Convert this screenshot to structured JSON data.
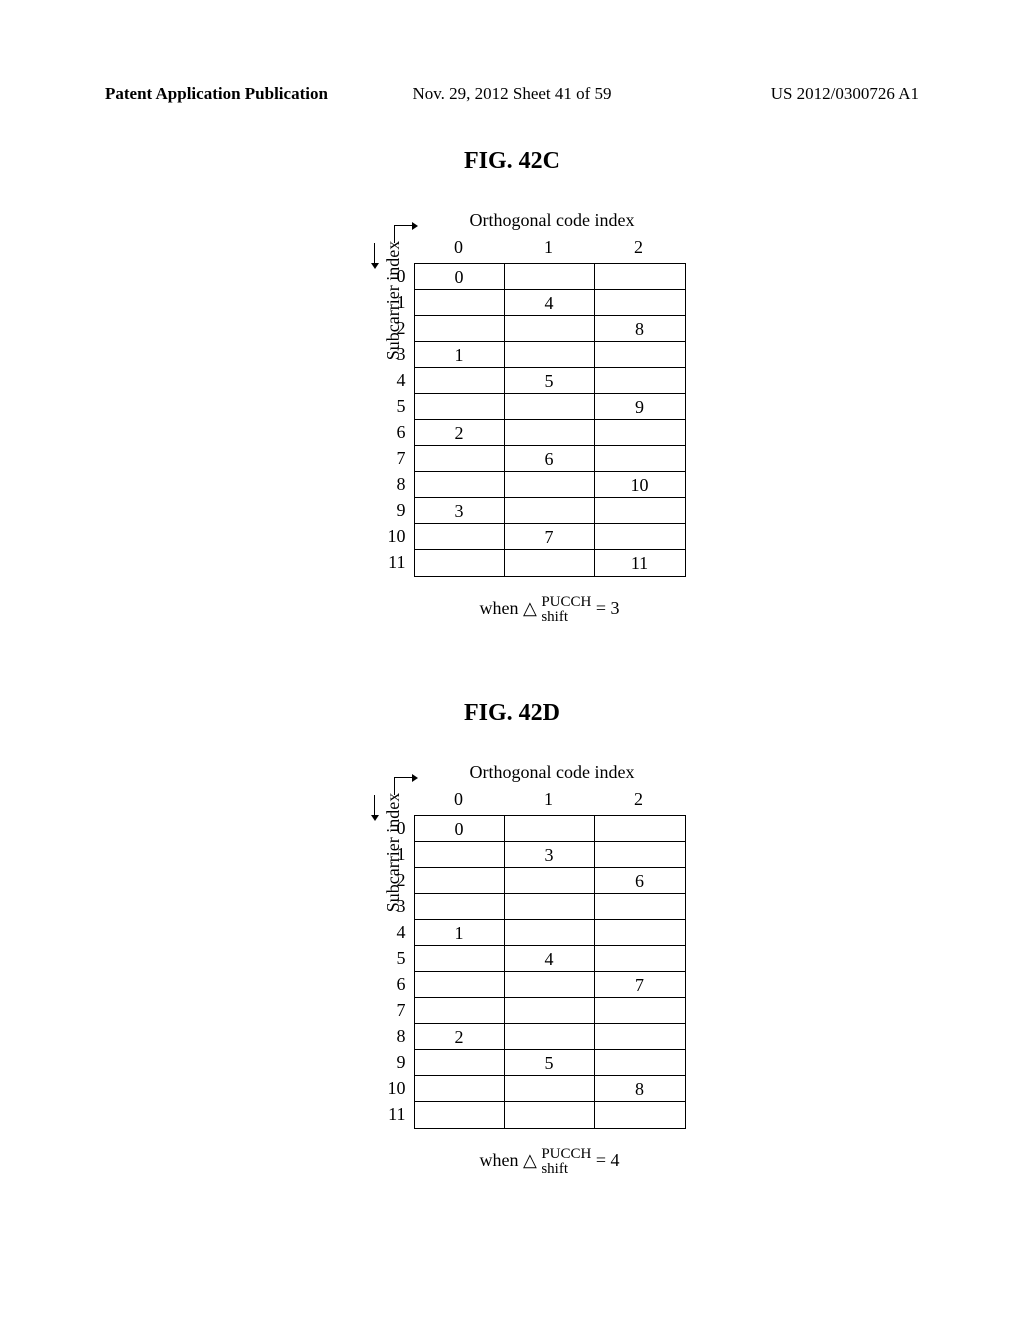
{
  "header": {
    "left": "Patent Application Publication",
    "center": "Nov. 29, 2012  Sheet 41 of 59",
    "right": "US 2012/0300726 A1"
  },
  "figC": {
    "title": "FIG.  42C",
    "topLabel": "Orthogonal code index",
    "sideLabel": "Subcarrier index",
    "colHeaders": [
      "0",
      "1",
      "2"
    ],
    "rowHeaders": [
      "0",
      "1",
      "2",
      "3",
      "4",
      "5",
      "6",
      "7",
      "8",
      "9",
      "10",
      "11"
    ],
    "formula": {
      "when": "when  ",
      "triangle": "△",
      "top": "PUCCH",
      "bot": "shift",
      "equals": " = 3"
    }
  },
  "figD": {
    "title": "FIG.  42D",
    "topLabel": "Orthogonal code index",
    "sideLabel": "Subcarrier index",
    "colHeaders": [
      "0",
      "1",
      "2"
    ],
    "rowHeaders": [
      "0",
      "1",
      "2",
      "3",
      "4",
      "5",
      "6",
      "7",
      "8",
      "9",
      "10",
      "11"
    ],
    "formula": {
      "when": "when  ",
      "triangle": "△",
      "top": "PUCCH",
      "bot": "shift",
      "equals": " = 4"
    }
  },
  "chart_data": [
    {
      "type": "table",
      "title": "FIG. 42C",
      "xlabel": "Orthogonal code index",
      "ylabel": "Subcarrier index",
      "col_headers": [
        0,
        1,
        2
      ],
      "row_headers": [
        0,
        1,
        2,
        3,
        4,
        5,
        6,
        7,
        8,
        9,
        10,
        11
      ],
      "cells": [
        {
          "row": 0,
          "col": 0,
          "value": 0
        },
        {
          "row": 1,
          "col": 1,
          "value": 4
        },
        {
          "row": 2,
          "col": 2,
          "value": 8
        },
        {
          "row": 3,
          "col": 0,
          "value": 1
        },
        {
          "row": 4,
          "col": 1,
          "value": 5
        },
        {
          "row": 5,
          "col": 2,
          "value": 9
        },
        {
          "row": 6,
          "col": 0,
          "value": 2
        },
        {
          "row": 7,
          "col": 1,
          "value": 6
        },
        {
          "row": 8,
          "col": 2,
          "value": 10
        },
        {
          "row": 9,
          "col": 0,
          "value": 3
        },
        {
          "row": 10,
          "col": 1,
          "value": 7
        },
        {
          "row": 11,
          "col": 2,
          "value": 11
        }
      ],
      "annotation": "when Δ_shift^PUCCH = 3"
    },
    {
      "type": "table",
      "title": "FIG. 42D",
      "xlabel": "Orthogonal code index",
      "ylabel": "Subcarrier index",
      "col_headers": [
        0,
        1,
        2
      ],
      "row_headers": [
        0,
        1,
        2,
        3,
        4,
        5,
        6,
        7,
        8,
        9,
        10,
        11
      ],
      "cells": [
        {
          "row": 0,
          "col": 0,
          "value": 0
        },
        {
          "row": 1,
          "col": 1,
          "value": 3
        },
        {
          "row": 2,
          "col": 2,
          "value": 6
        },
        {
          "row": 4,
          "col": 0,
          "value": 1
        },
        {
          "row": 5,
          "col": 1,
          "value": 4
        },
        {
          "row": 6,
          "col": 2,
          "value": 7
        },
        {
          "row": 8,
          "col": 0,
          "value": 2
        },
        {
          "row": 9,
          "col": 1,
          "value": 5
        },
        {
          "row": 10,
          "col": 2,
          "value": 8
        }
      ],
      "annotation": "when Δ_shift^PUCCH = 4"
    }
  ]
}
